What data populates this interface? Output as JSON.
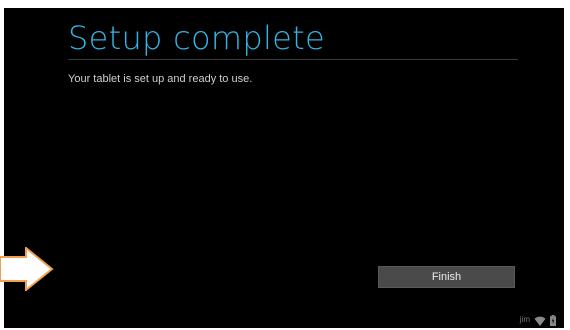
{
  "setup": {
    "title": "Setup complete",
    "subtitle": "Your tablet is set up and ready to use.",
    "finish_label": "Finish"
  },
  "statusbar": {
    "user": "jim",
    "icons": [
      "wifi-icon",
      "battery-icon"
    ]
  },
  "annotation": {
    "icon": "arrow-right-icon",
    "color": "#f0a050"
  },
  "colors": {
    "accent": "#33b5e5",
    "background": "#000000",
    "button": "#4a4a4a"
  }
}
